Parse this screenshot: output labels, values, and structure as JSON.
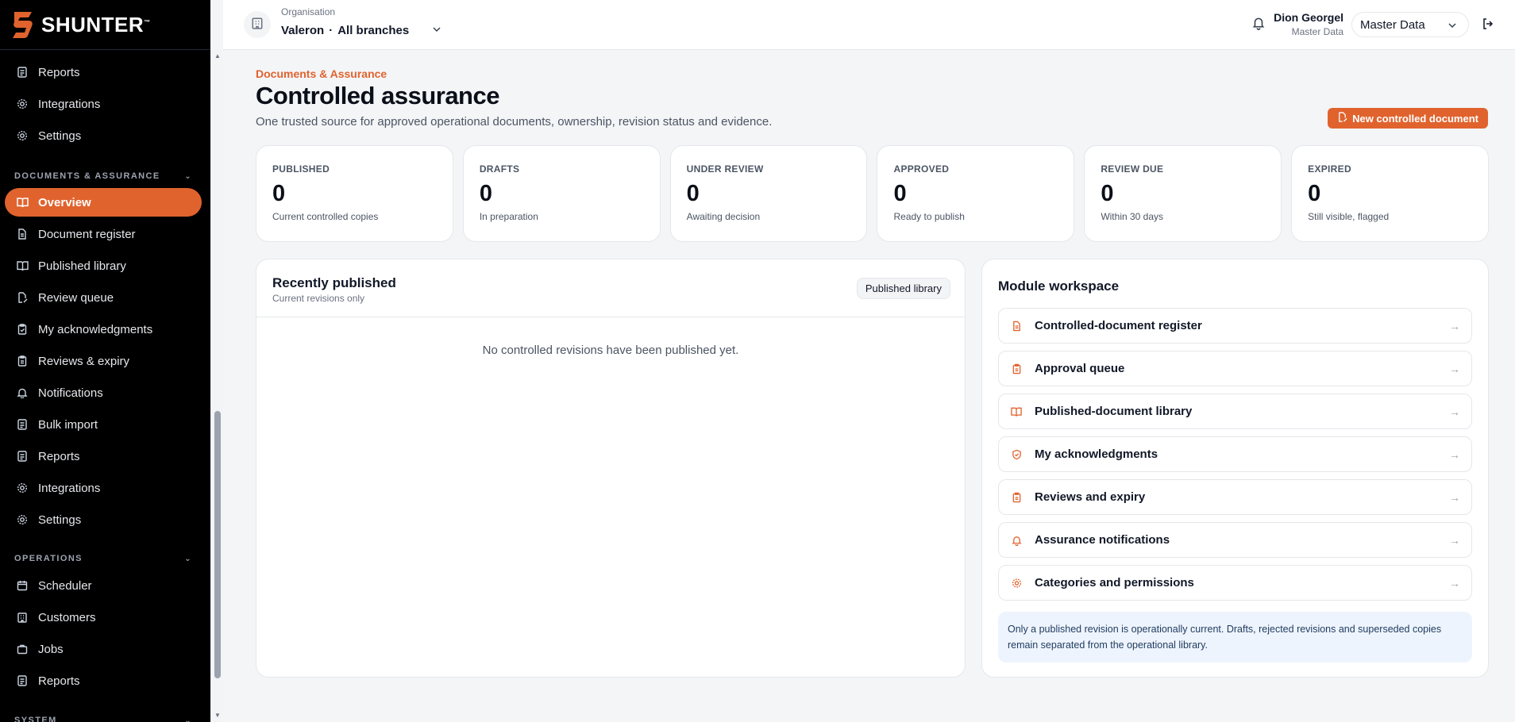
{
  "brand": {
    "name": "SHUNTER",
    "tm": "™"
  },
  "sidebar": {
    "top_items": [
      {
        "label": "Reports",
        "icon": "report-icon"
      },
      {
        "label": "Integrations",
        "icon": "gear-icon"
      },
      {
        "label": "Settings",
        "icon": "gear-icon"
      }
    ],
    "section_docs": "DOCUMENTS & ASSURANCE",
    "doc_items": [
      {
        "label": "Overview",
        "icon": "book-icon",
        "active": true
      },
      {
        "label": "Document register",
        "icon": "document-icon"
      },
      {
        "label": "Published library",
        "icon": "book-icon"
      },
      {
        "label": "Review queue",
        "icon": "edit-document-icon"
      },
      {
        "label": "My acknowledgments",
        "icon": "clipboard-check-icon"
      },
      {
        "label": "Reviews & expiry",
        "icon": "clipboard-icon"
      },
      {
        "label": "Notifications",
        "icon": "bell-icon"
      },
      {
        "label": "Bulk import",
        "icon": "import-icon"
      },
      {
        "label": "Reports",
        "icon": "report-icon"
      },
      {
        "label": "Integrations",
        "icon": "gear-icon"
      },
      {
        "label": "Settings",
        "icon": "gear-icon"
      }
    ],
    "section_ops": "OPERATIONS",
    "ops_items": [
      {
        "label": "Scheduler",
        "icon": "calendar-icon"
      },
      {
        "label": "Customers",
        "icon": "building-icon"
      },
      {
        "label": "Jobs",
        "icon": "briefcase-icon"
      },
      {
        "label": "Reports",
        "icon": "report-icon"
      }
    ],
    "section_system": "SYSTEM"
  },
  "topbar": {
    "org_label": "Organisation",
    "org_name": "Valeron",
    "org_sep": "·",
    "org_branch": "All branches",
    "user_name": "Dion Georgel",
    "user_role": "Master Data",
    "role_select": "Master Data"
  },
  "header": {
    "eyebrow": "Documents & Assurance",
    "title": "Controlled assurance",
    "subtitle": "One trusted source for approved operational documents, ownership, revision status and evidence.",
    "primary_button": "New controlled document"
  },
  "stats": [
    {
      "label": "PUBLISHED",
      "value": "0",
      "note": "Current controlled copies"
    },
    {
      "label": "DRAFTS",
      "value": "0",
      "note": "In preparation"
    },
    {
      "label": "UNDER REVIEW",
      "value": "0",
      "note": "Awaiting decision"
    },
    {
      "label": "APPROVED",
      "value": "0",
      "note": "Ready to publish"
    },
    {
      "label": "REVIEW DUE",
      "value": "0",
      "note": "Within 30 days"
    },
    {
      "label": "EXPIRED",
      "value": "0",
      "note": "Still visible, flagged"
    }
  ],
  "recent": {
    "title": "Recently published",
    "subtitle": "Current revisions only",
    "button": "Published library",
    "empty": "No controlled revisions have been published yet."
  },
  "workspace": {
    "title": "Module workspace",
    "items": [
      {
        "label": "Controlled-document register",
        "icon": "document-icon"
      },
      {
        "label": "Approval queue",
        "icon": "clipboard-icon"
      },
      {
        "label": "Published-document library",
        "icon": "book-icon"
      },
      {
        "label": "My acknowledgments",
        "icon": "shield-check-icon"
      },
      {
        "label": "Reviews and expiry",
        "icon": "clipboard-icon"
      },
      {
        "label": "Assurance notifications",
        "icon": "bell-icon"
      },
      {
        "label": "Categories and permissions",
        "icon": "gear-icon"
      }
    ],
    "notice": "Only a published revision is operationally current. Drafts, rejected revisions and superseded copies remain separated from the operational library."
  },
  "colors": {
    "accent": "#e0632e",
    "sidebar_bg": "#000000",
    "notice_bg": "#eef4fd"
  }
}
